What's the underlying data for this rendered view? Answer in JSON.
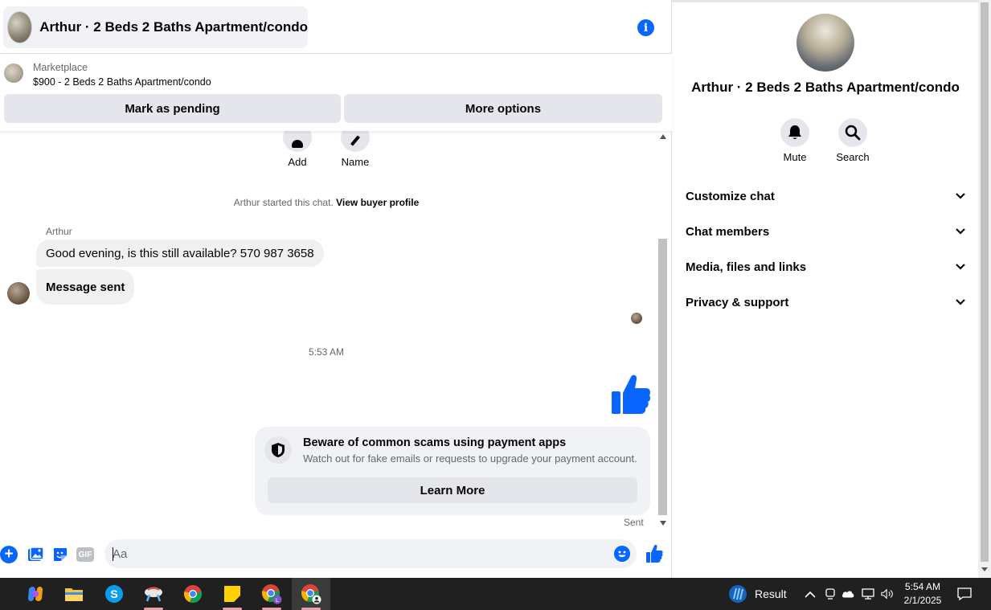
{
  "header": {
    "title": "Arthur · 2 Beds 2 Baths Apartment/condo"
  },
  "listing": {
    "source": "Marketplace",
    "title": "$900 - 2 Beds 2 Baths Apartment/condo",
    "mark_pending_label": "Mark as pending",
    "more_options_label": "More options"
  },
  "messages": {
    "add_label": "Add",
    "name_label": "Name",
    "system_text": "Arthur started this chat.",
    "system_link": "View buyer profile",
    "sender": "Arthur",
    "message_1": "Good evening, is this still available? 570 987 3658",
    "message_2": "Message sent",
    "timestamp": "5:53 AM",
    "scam_title": "Beware of common scams using payment apps",
    "scam_body": "Watch out for fake emails or requests to upgrade your payment account.",
    "learn_more_label": "Learn More",
    "sent_label": "Sent"
  },
  "composer": {
    "placeholder": "Aa",
    "gif_label": "GIF"
  },
  "details": {
    "title": "Arthur · 2 Beds 2 Baths Apartment/condo",
    "mute_label": "Mute",
    "search_label": "Search",
    "sections": [
      "Customize chat",
      "Chat members",
      "Media, files and links",
      "Privacy & support"
    ]
  },
  "taskbar": {
    "weather_label": "Result",
    "time": "5:54 AM",
    "date": "2/1/2025"
  },
  "colors": {
    "accent": "#0866ff",
    "bubble": "#f0f0f0",
    "button": "#e4e6eb"
  }
}
